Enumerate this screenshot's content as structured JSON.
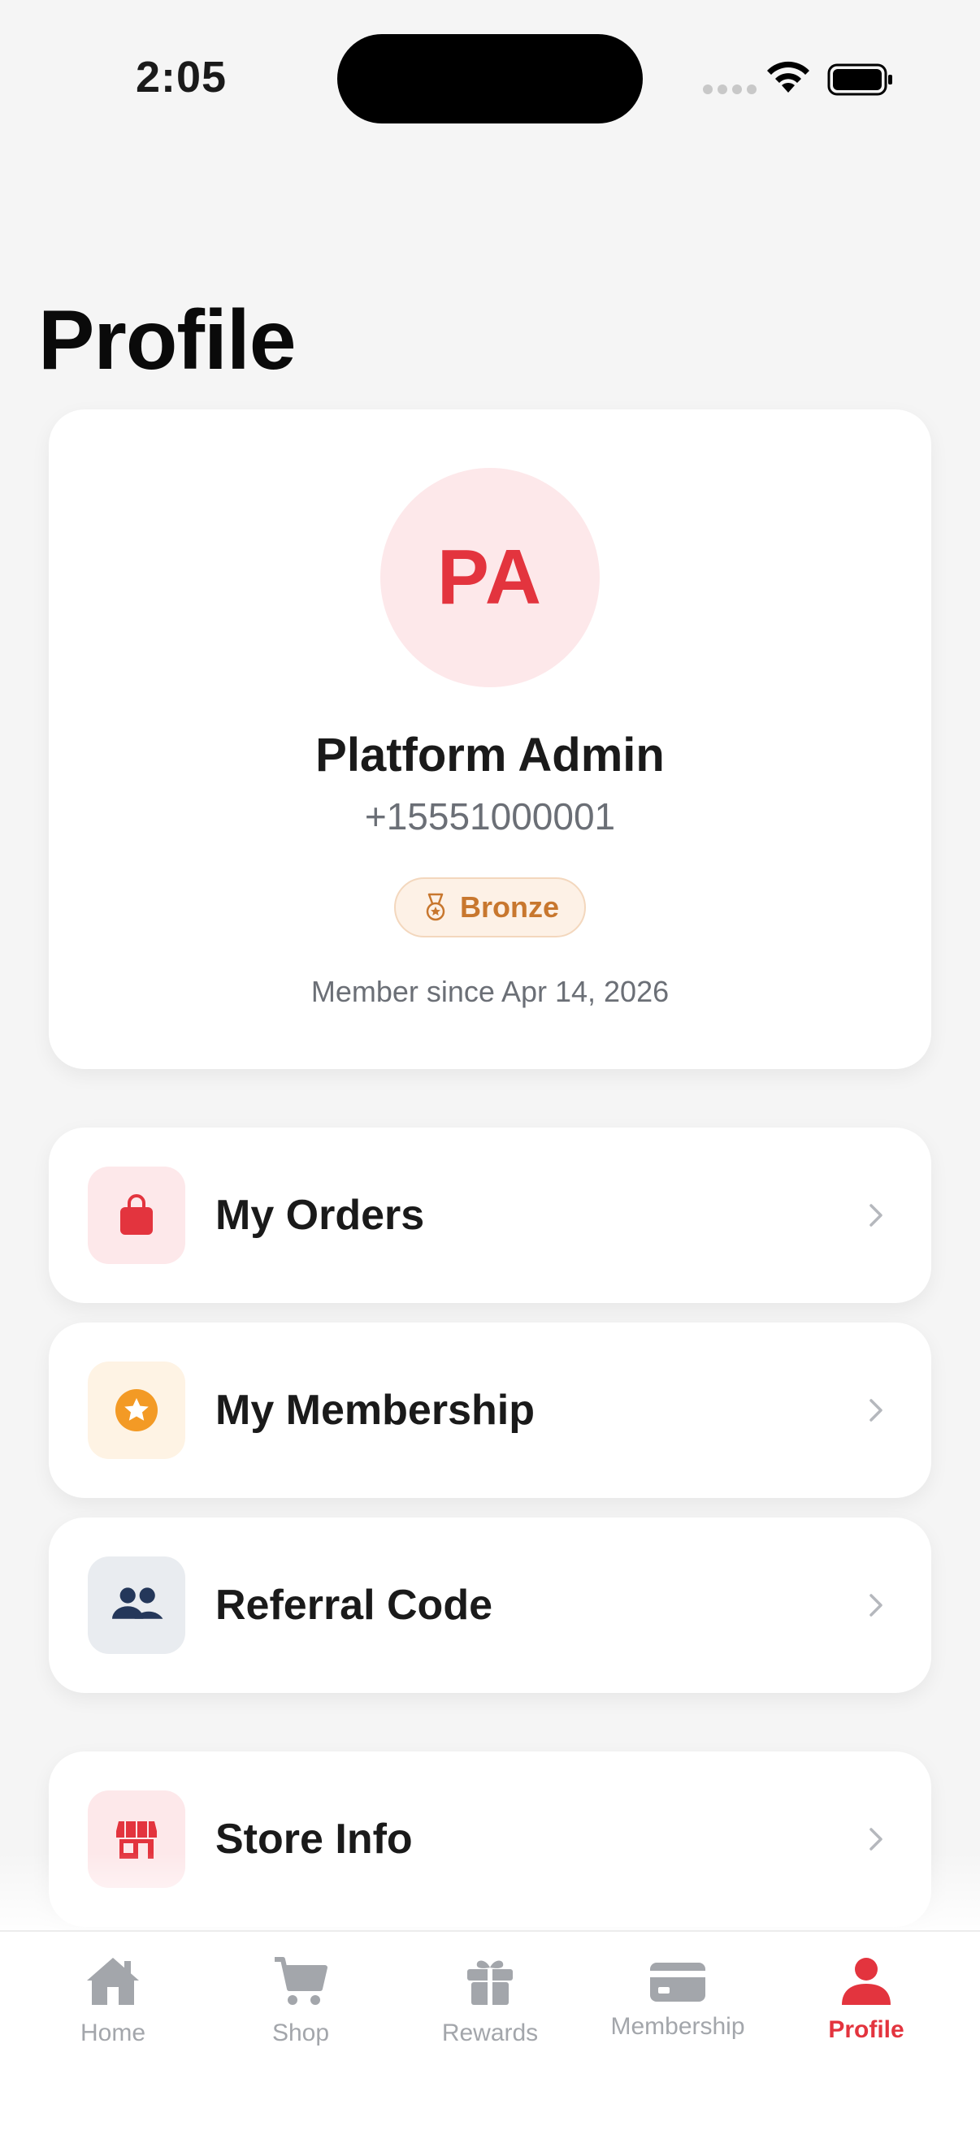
{
  "status_bar": {
    "time": "2:05"
  },
  "header": {
    "title": "Profile"
  },
  "profile": {
    "initials": "PA",
    "name": "Platform Admin",
    "phone": "+15551000001",
    "tier": "Bronze",
    "member_since": "Member since Apr 14, 2026"
  },
  "menu": {
    "orders": {
      "label": "My Orders",
      "icon": "shopping-bag-icon"
    },
    "membership": {
      "label": "My Membership",
      "icon": "star-circle-icon"
    },
    "referral": {
      "label": "Referral Code",
      "icon": "people-icon"
    },
    "store": {
      "label": "Store Info",
      "icon": "storefront-icon"
    }
  },
  "tabs": [
    {
      "label": "Home",
      "icon": "home-icon",
      "active": false
    },
    {
      "label": "Shop",
      "icon": "cart-icon",
      "active": false
    },
    {
      "label": "Rewards",
      "icon": "gift-icon",
      "active": false
    },
    {
      "label": "Membership",
      "icon": "card-icon",
      "active": false
    },
    {
      "label": "Profile",
      "icon": "person-icon",
      "active": true
    }
  ],
  "colors": {
    "accent": "#e3343e",
    "bronze": "#c8772e",
    "membership_orange": "#f39a25",
    "referral_navy": "#24375a",
    "inactive_tab": "#a3a6ab"
  }
}
